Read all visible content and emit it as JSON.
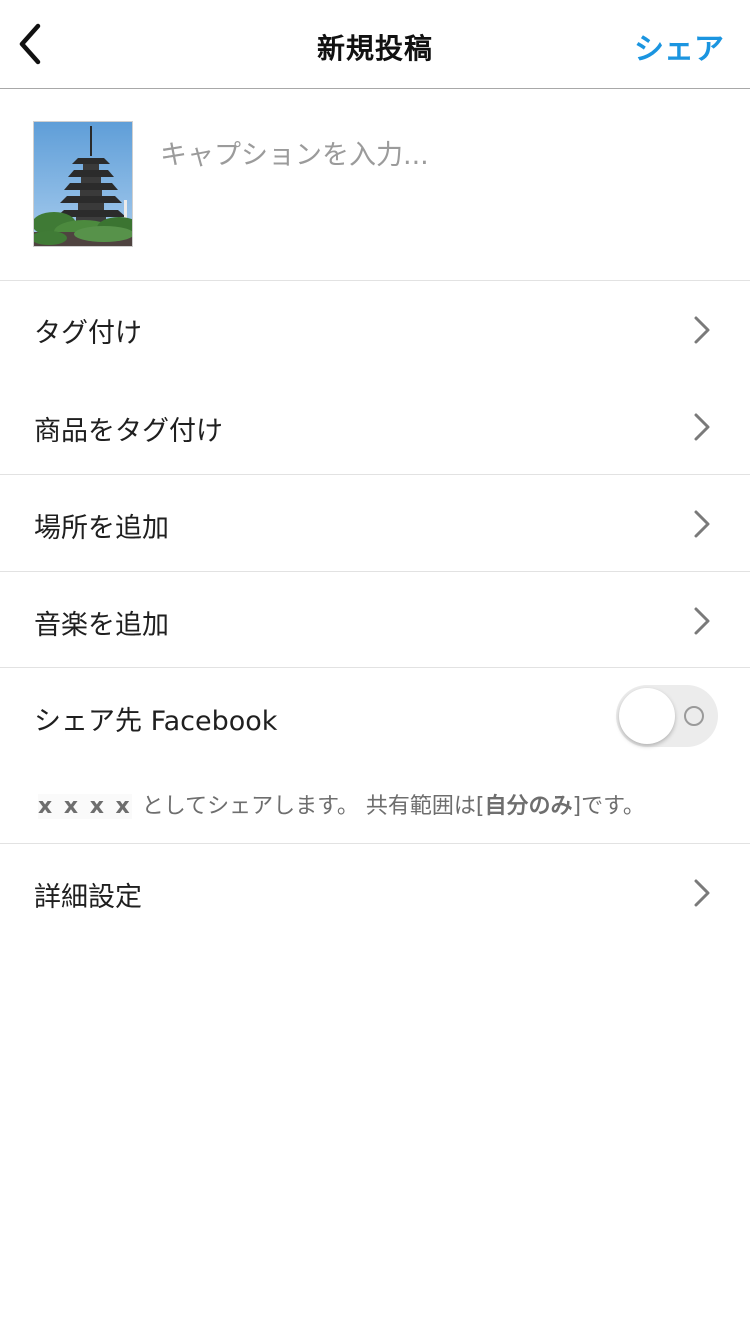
{
  "header": {
    "title": "新規投稿",
    "share_label": "シェア"
  },
  "caption": {
    "placeholder": "キャプションを入力..."
  },
  "rows": {
    "tag_people": "タグ付け",
    "tag_products": "商品をタグ付け",
    "add_location": "場所を追加",
    "add_music": "音楽を追加",
    "share_facebook": "シェア先 Facebook",
    "advanced": "詳細設定"
  },
  "facebook": {
    "enabled": false
  },
  "note": {
    "username": "x x x x",
    "text_before": "としてシェアします。 共有範囲は[",
    "audience": "自分のみ",
    "text_after": "]です。"
  },
  "colors": {
    "accent": "#1b95e0",
    "divider": "#e2e2e2",
    "chevron": "#7a7a7a"
  },
  "icons": {
    "back": "back-arrow-icon",
    "chevron": "chevron-right-icon"
  }
}
